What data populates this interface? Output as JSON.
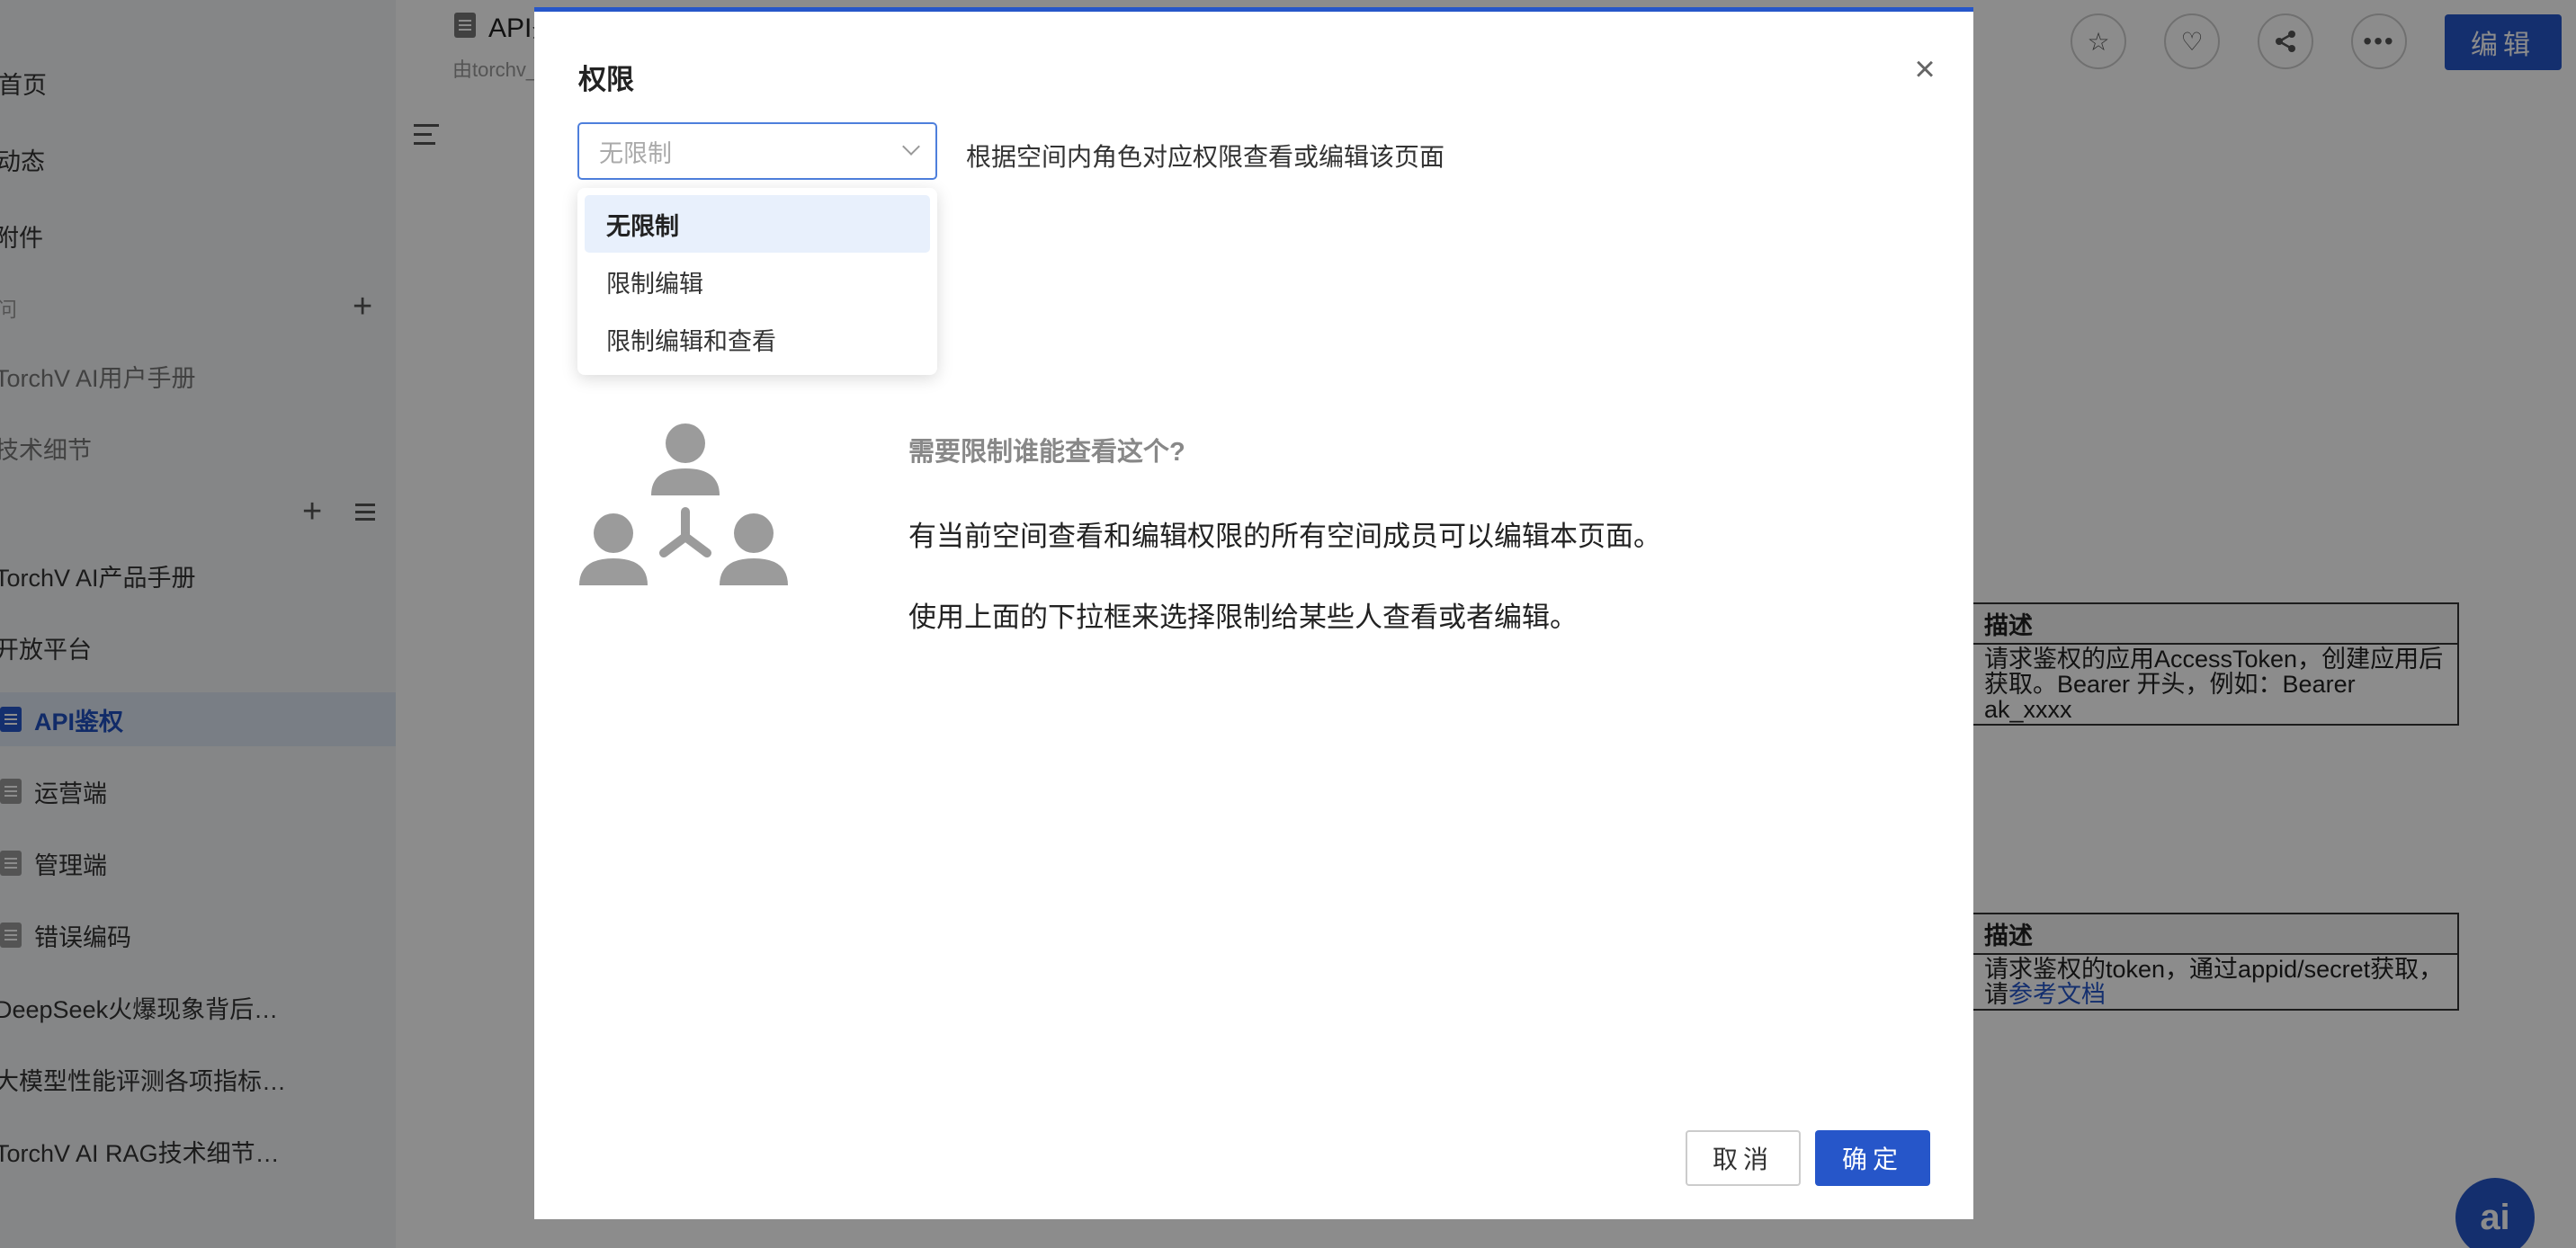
{
  "sidebar": {
    "items": [
      {
        "label": "首页"
      },
      {
        "label": "动态"
      },
      {
        "label": "附件"
      },
      {
        "label": "问"
      },
      {
        "label": "TorchV AI用户手册"
      },
      {
        "label": "技术细节"
      },
      {
        "label": "TorchV AI产品手册"
      },
      {
        "label": "开放平台"
      },
      {
        "label": "API鉴权"
      },
      {
        "label": "运营端"
      },
      {
        "label": "管理端"
      },
      {
        "label": "错误编码"
      },
      {
        "label": "DeepSeek火爆现象背后…"
      },
      {
        "label": "大模型性能评测各项指标…"
      },
      {
        "label": "TorchV AI RAG技术细节…"
      }
    ]
  },
  "page": {
    "title": "API鉴",
    "subtitle": "由torchv_",
    "edit_label": "编辑"
  },
  "tables": [
    {
      "header": "描述",
      "cell": "请求鉴权的应用AccessToken，创建应用后获取。Bearer 开头，例如：Bearer ak_xxxx"
    },
    {
      "header": "描述",
      "cell_prefix": "请求鉴权的token，通过appid/secret获取，请",
      "cell_link": "参考文档"
    }
  ],
  "ai_fab_label": "ai",
  "modal": {
    "title": "权限",
    "select": {
      "placeholder": "无限制",
      "hint": "根据空间内角色对应权限查看或编辑该页面",
      "options": [
        {
          "label": "无限制",
          "selected": true
        },
        {
          "label": "限制编辑",
          "selected": false
        },
        {
          "label": "限制编辑和查看",
          "selected": false
        }
      ]
    },
    "info": {
      "question": "需要限制谁能查看这个?",
      "line1": "有当前空间查看和编辑权限的所有空间成员可以编辑本页面。",
      "line2": "使用上面的下拉框来选择限制给某些人查看或者编辑。"
    },
    "cancel_label": "取消",
    "ok_label": "确定"
  },
  "colors": {
    "accent": "#2656c9",
    "overlay": "rgba(0,0,0,0.45)"
  }
}
